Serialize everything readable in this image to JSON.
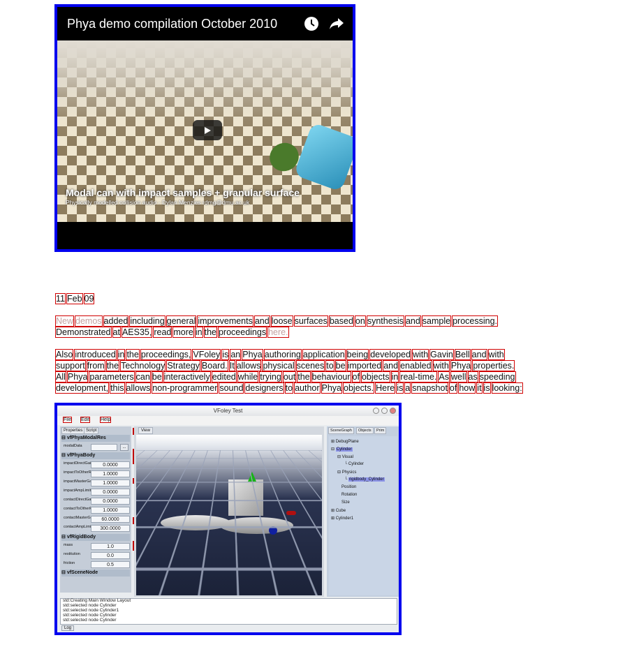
{
  "video": {
    "title": "Phya demo compilation October 2010",
    "caption_main": "Modal can with impact samples + granular surface",
    "caption_sub": "Physically modelled collision audio - Dylan Menzies rdmg@dmu.ac.uk",
    "icons": [
      "clock-icon",
      "share-icon",
      "play-icon"
    ]
  },
  "article": {
    "date": [
      "11",
      "Feb",
      "09"
    ],
    "para1_line1": [
      "New",
      "demos",
      "added",
      "including",
      "general",
      "improvements",
      "and",
      "loose",
      "surfaces",
      "based",
      "on",
      "synthesis",
      "and",
      "sample",
      "processing."
    ],
    "para1_line2": [
      "Demonstrated",
      "at",
      "AES35,",
      "read",
      "more",
      "in",
      "the",
      "proceedings",
      "here."
    ],
    "para2_line1": [
      "Also",
      "introduced",
      "in",
      "the",
      "proceedings,",
      "VFoley",
      "is",
      "an",
      "Phya",
      "authoring",
      "application",
      "being",
      "developed",
      "with",
      "Gavin",
      "Bell",
      "and",
      "with"
    ],
    "para2_line2": [
      "support",
      "from",
      "the",
      "Technology",
      "Strategy",
      "Board.",
      "It",
      "allows",
      "physical",
      "scenes",
      "to",
      "be",
      "imported",
      "and",
      "enabled",
      "with",
      "Phya",
      "properties."
    ],
    "para2_line3": [
      "All",
      "Phya",
      "parameters",
      "can",
      "be",
      "interactively",
      "edited",
      "while",
      "trying",
      "out",
      "the",
      "behaviour",
      "of",
      "objects",
      "in",
      "real-time.",
      "As",
      "well",
      "as",
      "speeding"
    ],
    "para2_line4": [
      "development,",
      "this",
      "allows",
      "non-programmer",
      "sound",
      "designers",
      "to",
      "author",
      "Phya",
      "objects.",
      "Here",
      "is",
      "a",
      "snapshot",
      "of",
      "how",
      "it",
      "is",
      "looking:"
    ]
  },
  "vfoley": {
    "window_title": "VFoley Test",
    "menu": [
      "File",
      "Edit",
      "Help"
    ],
    "left_tabs": [
      "Properties",
      "Script"
    ],
    "view_tab": "View",
    "right_tabs": [
      "SceneGraph",
      "Objects",
      "Prim"
    ],
    "sections": {
      "modal": "vfPhyaModalRes",
      "body": "vfPhyaBody",
      "rigid": "vfRigidBody",
      "scene": "vfSceneNode"
    },
    "modal_data_label": "modalData",
    "body_rows": [
      {
        "label": "impactDirectGain",
        "value": "0.0000"
      },
      {
        "label": "impactToOtherResGain",
        "value": "1.0000"
      },
      {
        "label": "impactMasterGain",
        "value": "1.0000"
      },
      {
        "label": "impactAmpLimit",
        "value": "0.0000"
      },
      {
        "label": "contactDirectGain",
        "value": "0.0000"
      },
      {
        "label": "contactToOtherResGain",
        "value": "1.0000"
      },
      {
        "label": "contactMasterGain",
        "value": "60.0000"
      },
      {
        "label": "contactAmpLimit",
        "value": "300.0000"
      }
    ],
    "rigid_rows": [
      {
        "label": "mass",
        "value": "1.0"
      },
      {
        "label": "restitution",
        "value": "0.0"
      },
      {
        "label": "friction",
        "value": "0.5"
      }
    ],
    "tree": [
      "DebugPlane",
      "Cylinder",
      "Visual",
      "Cylinder",
      "Physics",
      "rigidbody_Cylinder",
      "Position",
      "Rotation",
      "Size",
      "Cube",
      "Cylinder1"
    ],
    "log": [
      "std:Creating Main Window Layout",
      "std:selected node Cylinder",
      "std:selected node Cylinder1",
      "std:selected node Cylinder",
      "std:selected node Cylinder"
    ],
    "log_tab": "Log"
  }
}
